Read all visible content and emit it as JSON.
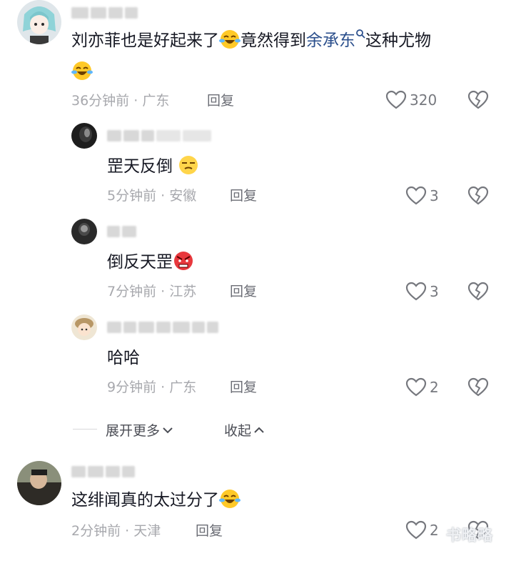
{
  "comments": [
    {
      "text_before": "刘亦菲也是好起来了",
      "text_mid": "竟然得到",
      "link": "余承东",
      "text_after": "这种尤物",
      "time": "36分钟前",
      "location": "广东",
      "reply": "回复",
      "likes": "320"
    },
    {
      "text": "罡天反倒",
      "time": "5分钟前",
      "location": "安徽",
      "reply": "回复",
      "likes": "3"
    },
    {
      "text": "倒反天罡",
      "time": "7分钟前",
      "location": "江苏",
      "reply": "回复",
      "likes": "3"
    },
    {
      "text": "哈哈",
      "time": "9分钟前",
      "location": "广东",
      "reply": "回复",
      "likes": "2"
    },
    {
      "text": "这绯闻真的太过分了",
      "time": "2分钟前",
      "location": "天津",
      "reply": "回复",
      "likes": "2"
    }
  ],
  "expand_label": "展开更多",
  "collapse_label": "收起",
  "separator": "·",
  "watermark": "书略略",
  "icons": {
    "like": "heart-outline-icon",
    "dislike": "broken-heart-icon",
    "expand": "chevron-down-icon",
    "collapse": "chevron-up-icon",
    "search": "search-icon"
  }
}
